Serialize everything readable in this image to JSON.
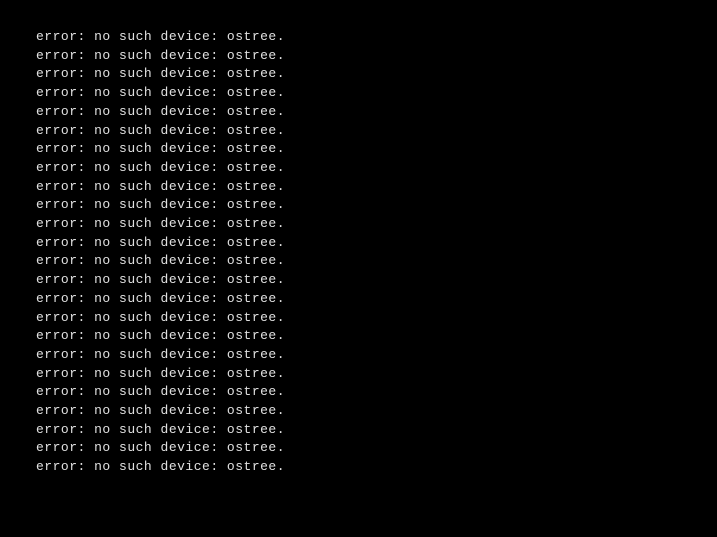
{
  "terminal": {
    "error_message": "error: no such device: ostree.",
    "line_count": 24
  }
}
